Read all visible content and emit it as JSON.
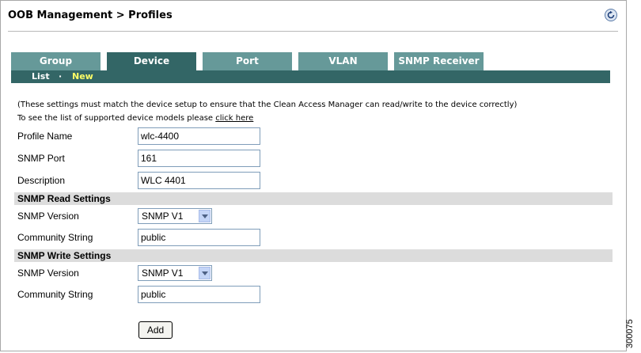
{
  "header": {
    "title": "OOB Management > Profiles",
    "refresh_icon": "refresh-icon"
  },
  "tabs": [
    {
      "label": "Group",
      "active": false
    },
    {
      "label": "Device",
      "active": true
    },
    {
      "label": "Port",
      "active": false
    },
    {
      "label": "VLAN",
      "active": false
    },
    {
      "label": "SNMP Receiver",
      "active": false
    }
  ],
  "subnav": {
    "list_label": "List",
    "separator": "·",
    "new_label": "New",
    "new_color": "#ffff66"
  },
  "notes": {
    "line1": "(These settings must match the device setup to ensure that the Clean Access Manager can read/write to the device correctly)",
    "line2_prefix": "To see the list of supported device models please ",
    "line2_link": "click here"
  },
  "form": {
    "profile_name_label": "Profile Name",
    "profile_name_value": "wlc-4400",
    "snmp_port_label": "SNMP Port",
    "snmp_port_value": "161",
    "description_label": "Description",
    "description_value": "WLC 4401",
    "read_section": "SNMP Read Settings",
    "read_version_label": "SNMP Version",
    "read_version_value": "SNMP V1",
    "read_community_label": "Community String",
    "read_community_value": "public",
    "write_section": "SNMP Write Settings",
    "write_version_label": "SNMP Version",
    "write_version_value": "SNMP V1",
    "write_community_label": "Community String",
    "write_community_value": "public",
    "add_label": "Add"
  },
  "figure_number": "300075",
  "colors": {
    "tab_inactive": "#669999",
    "tab_active": "#336666",
    "section_bg": "#dcdcdc"
  }
}
